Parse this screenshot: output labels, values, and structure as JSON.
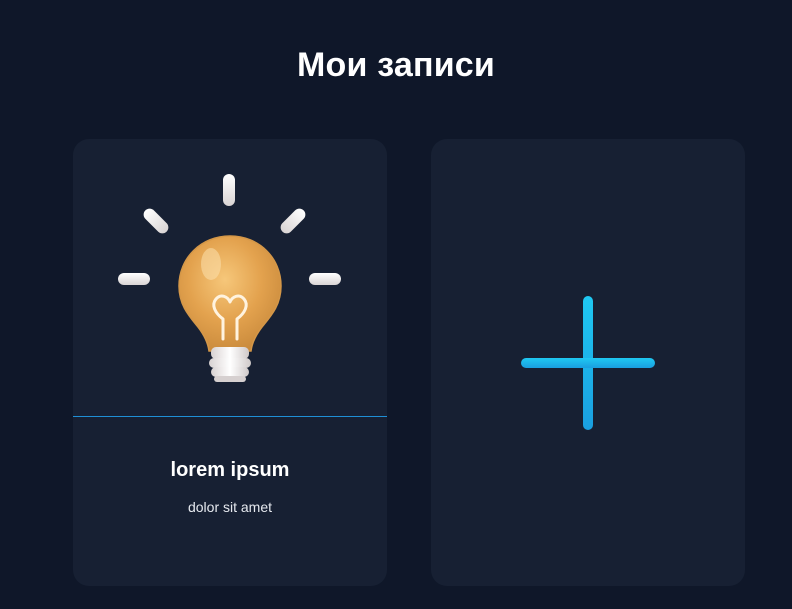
{
  "page": {
    "title": "Мои записи"
  },
  "notes": [
    {
      "title": "lorem ipsum",
      "subtitle": "dolor sit amet",
      "image_icon": "lightbulb-icon"
    }
  ],
  "add_card": {
    "icon": "plus-icon"
  },
  "colors": {
    "background": "#0f1729",
    "card": "#172033",
    "accent": "#1ab8e8",
    "divider": "#1f8fd6",
    "bulb": "#e0a855"
  }
}
